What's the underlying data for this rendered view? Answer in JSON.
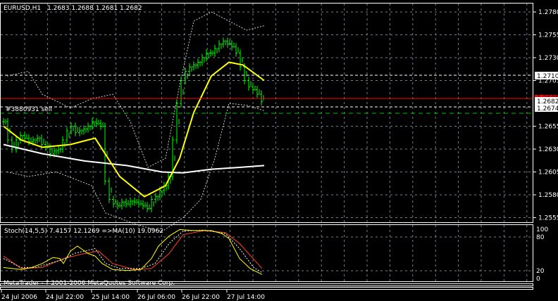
{
  "header": {
    "symbol": "EURUSD,H1",
    "ohlc": "1.2683 1.2688 1.2681 1.2682"
  },
  "price_axis": [
    "1.2780",
    "1.2755",
    "1.2730",
    "1.2705",
    "1.2655",
    "1.2630",
    "1.2605",
    "1.2580",
    "1.2555"
  ],
  "price_labels": {
    "upper": "1.2710",
    "bid": "1.2682",
    "lower": "1.2674",
    "red_line": "1.2685"
  },
  "order_label": "#3880931 sell",
  "indicator": {
    "title": "Stoch(14,5,5) 7.4157 12.1269  =>MA(10) 19.0962",
    "levels": [
      "100",
      "80",
      "20",
      "0"
    ],
    "copyright": "MetaTrader - ? 2001-2006 MetaQuotes Software Corp."
  },
  "time_axis": [
    "24 Jul 2006",
    "24 Jul 22:00",
    "25 Jul 14:00",
    "26 Jul 06:00",
    "26 Jul 22:00",
    "27 Jul 14:00"
  ],
  "colors": {
    "bull": "#00ff00",
    "ma_fast": "#ffff00",
    "ma_slow": "#ffffff",
    "red": "#ff0000",
    "stoch_sig": "#ff4422",
    "grid": "#708090"
  },
  "chart_data": {
    "type": "line",
    "title": "EURUSD,H1",
    "ylim": [
      1.2547,
      1.2792
    ],
    "close": [
      1.266,
      1.264,
      1.263,
      1.264,
      1.2645,
      1.2642,
      1.2638,
      1.264,
      1.2642,
      1.2635,
      1.2632,
      1.2625,
      1.2628,
      1.263,
      1.264,
      1.265,
      1.2655,
      1.2648,
      1.265,
      1.2652,
      1.2655,
      1.266,
      1.2658,
      1.2655,
      1.2595,
      1.2575,
      1.257,
      1.2568,
      1.2572,
      1.257,
      1.2573,
      1.2572,
      1.257,
      1.2568,
      1.2565,
      1.2575,
      1.2578,
      1.2585,
      1.259,
      1.26,
      1.264,
      1.268,
      1.2705,
      1.2715,
      1.272,
      1.2722,
      1.2725,
      1.273,
      1.2735,
      1.2735,
      1.274,
      1.2745,
      1.2748,
      1.2745,
      1.2742,
      1.2735,
      1.272,
      1.2705,
      1.2698,
      1.2695,
      1.269,
      1.2682
    ],
    "ma_fast": [
      [
        5,
        1.2655
      ],
      [
        30,
        1.264
      ],
      [
        60,
        1.2632
      ],
      [
        100,
        1.2635
      ],
      [
        135,
        1.2642
      ],
      [
        170,
        1.26
      ],
      [
        205,
        1.2578
      ],
      [
        235,
        1.259
      ],
      [
        255,
        1.262
      ],
      [
        275,
        1.267
      ],
      [
        300,
        1.271
      ],
      [
        325,
        1.2725
      ],
      [
        345,
        1.2722
      ],
      [
        375,
        1.2705
      ]
    ],
    "ma_slow": [
      [
        5,
        1.2635
      ],
      [
        60,
        1.2625
      ],
      [
        120,
        1.2617
      ],
      [
        180,
        1.2612
      ],
      [
        230,
        1.2605
      ],
      [
        260,
        1.2604
      ],
      [
        300,
        1.2608
      ],
      [
        340,
        1.261
      ],
      [
        375,
        1.2612
      ]
    ],
    "bb_upper": [
      [
        10,
        1.271
      ],
      [
        40,
        1.2715
      ],
      [
        60,
        1.269
      ],
      [
        100,
        1.2675
      ],
      [
        130,
        1.2685
      ],
      [
        160,
        1.269
      ],
      [
        185,
        1.266
      ],
      [
        210,
        1.261
      ],
      [
        235,
        1.262
      ],
      [
        255,
        1.27
      ],
      [
        275,
        1.277
      ],
      [
        300,
        1.278
      ],
      [
        325,
        1.277
      ],
      [
        350,
        1.276
      ],
      [
        375,
        1.2765
      ]
    ],
    "bb_lower": [
      [
        10,
        1.2605
      ],
      [
        40,
        1.26
      ],
      [
        80,
        1.2605
      ],
      [
        130,
        1.259
      ],
      [
        150,
        1.256
      ],
      [
        185,
        1.255
      ],
      [
        205,
        1.2545
      ],
      [
        230,
        1.254
      ],
      [
        260,
        1.2555
      ],
      [
        285,
        1.2575
      ],
      [
        305,
        1.262
      ],
      [
        325,
        1.268
      ],
      [
        350,
        1.2678
      ],
      [
        375,
        1.2672
      ]
    ],
    "stoch_main": [
      [
        5,
        22
      ],
      [
        30,
        18
      ],
      [
        45,
        22
      ],
      [
        60,
        30
      ],
      [
        75,
        42
      ],
      [
        85,
        40
      ],
      [
        90,
        30
      ],
      [
        100,
        55
      ],
      [
        110,
        65
      ],
      [
        125,
        50
      ],
      [
        135,
        45
      ],
      [
        145,
        30
      ],
      [
        160,
        18
      ],
      [
        180,
        16
      ],
      [
        200,
        18
      ],
      [
        215,
        40
      ],
      [
        225,
        65
      ],
      [
        240,
        85
      ],
      [
        255,
        98
      ],
      [
        275,
        96
      ],
      [
        300,
        96
      ],
      [
        315,
        90
      ],
      [
        325,
        80
      ],
      [
        340,
        40
      ],
      [
        355,
        20
      ],
      [
        372,
        8
      ]
    ],
    "stoch_signal": [
      [
        5,
        40
      ],
      [
        30,
        22
      ],
      [
        50,
        22
      ],
      [
        70,
        30
      ],
      [
        90,
        38
      ],
      [
        105,
        50
      ],
      [
        120,
        55
      ],
      [
        135,
        60
      ],
      [
        150,
        30
      ],
      [
        170,
        20
      ],
      [
        200,
        20
      ],
      [
        220,
        30
      ],
      [
        240,
        70
      ],
      [
        260,
        95
      ],
      [
        290,
        97
      ],
      [
        320,
        90
      ],
      [
        340,
        60
      ],
      [
        360,
        22
      ],
      [
        372,
        12
      ]
    ],
    "stoch_ma": [
      [
        5,
        45
      ],
      [
        30,
        20
      ],
      [
        60,
        22
      ],
      [
        90,
        40
      ],
      [
        120,
        50
      ],
      [
        140,
        55
      ],
      [
        160,
        30
      ],
      [
        190,
        18
      ],
      [
        215,
        20
      ],
      [
        240,
        50
      ],
      [
        260,
        88
      ],
      [
        290,
        96
      ],
      [
        320,
        92
      ],
      [
        340,
        70
      ],
      [
        372,
        20
      ]
    ]
  }
}
